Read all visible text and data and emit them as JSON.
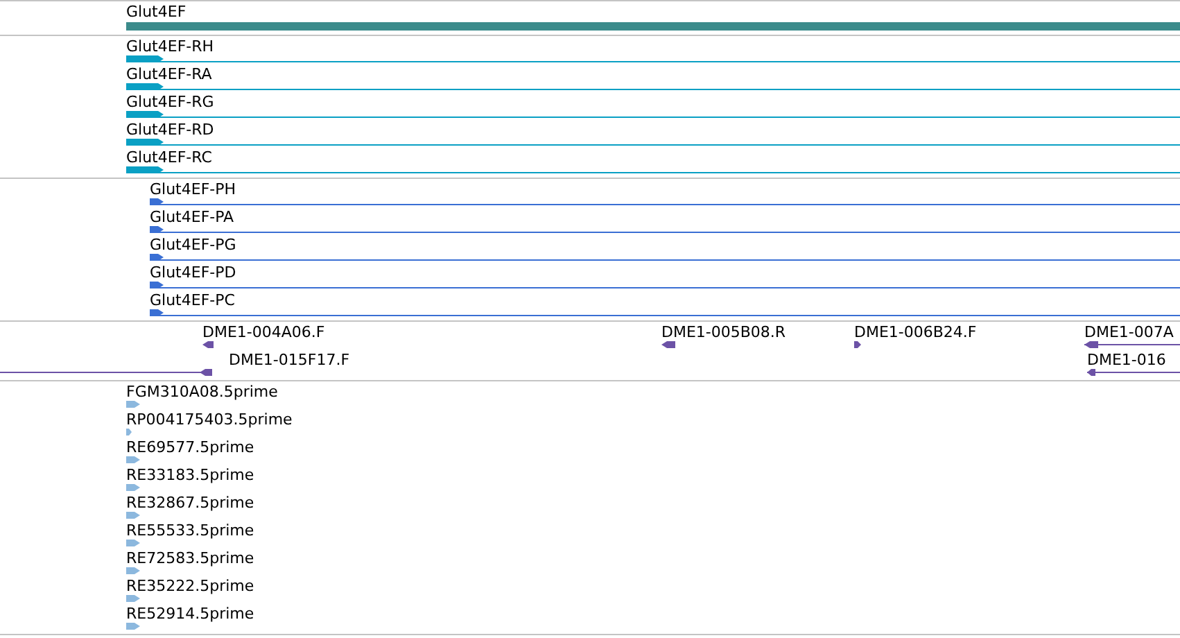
{
  "tracks": [
    {
      "kind": "gene",
      "features": [
        {
          "label": "Glut4EF"
        }
      ]
    },
    {
      "kind": "transcript",
      "features": [
        {
          "label": "Glut4EF-RH",
          "reverse": false
        },
        {
          "label": "Glut4EF-RA",
          "reverse": false
        },
        {
          "label": "Glut4EF-RG",
          "reverse": false
        },
        {
          "label": "Glut4EF-RD",
          "reverse": false
        },
        {
          "label": "Glut4EF-RC",
          "reverse": false
        }
      ]
    },
    {
      "kind": "protein",
      "features": [
        {
          "label": "Glut4EF-PH",
          "reverse": false
        },
        {
          "label": "Glut4EF-PA",
          "reverse": false
        },
        {
          "label": "Glut4EF-PG",
          "reverse": false
        },
        {
          "label": "Glut4EF-PD",
          "reverse": false
        },
        {
          "label": "Glut4EF-PC",
          "reverse": false
        }
      ]
    },
    {
      "kind": "clone",
      "features": [
        {
          "label": "DME1-004A06.F",
          "reverse": true
        },
        {
          "label": "DME1-005B08.R",
          "reverse": true
        },
        {
          "label": "DME1-006B24.F",
          "reverse": false
        },
        {
          "label": "DME1-007A",
          "reverse": true
        },
        {
          "label": "DME1-015F17.F",
          "reverse": true
        },
        {
          "label": "DME1-016",
          "reverse": true
        }
      ]
    },
    {
      "kind": "est",
      "features": [
        {
          "label": "FGM310A08.5prime",
          "reverse": false
        },
        {
          "label": "RP004175403.5prime",
          "reverse": false
        },
        {
          "label": "RE69577.5prime",
          "reverse": false
        },
        {
          "label": "RE33183.5prime",
          "reverse": false
        },
        {
          "label": "RE32867.5prime",
          "reverse": false
        },
        {
          "label": "RE55533.5prime",
          "reverse": false
        },
        {
          "label": "RE72583.5prime",
          "reverse": false
        },
        {
          "label": "RE35222.5prime",
          "reverse": false
        },
        {
          "label": "RE52914.5prime",
          "reverse": false
        }
      ]
    }
  ]
}
